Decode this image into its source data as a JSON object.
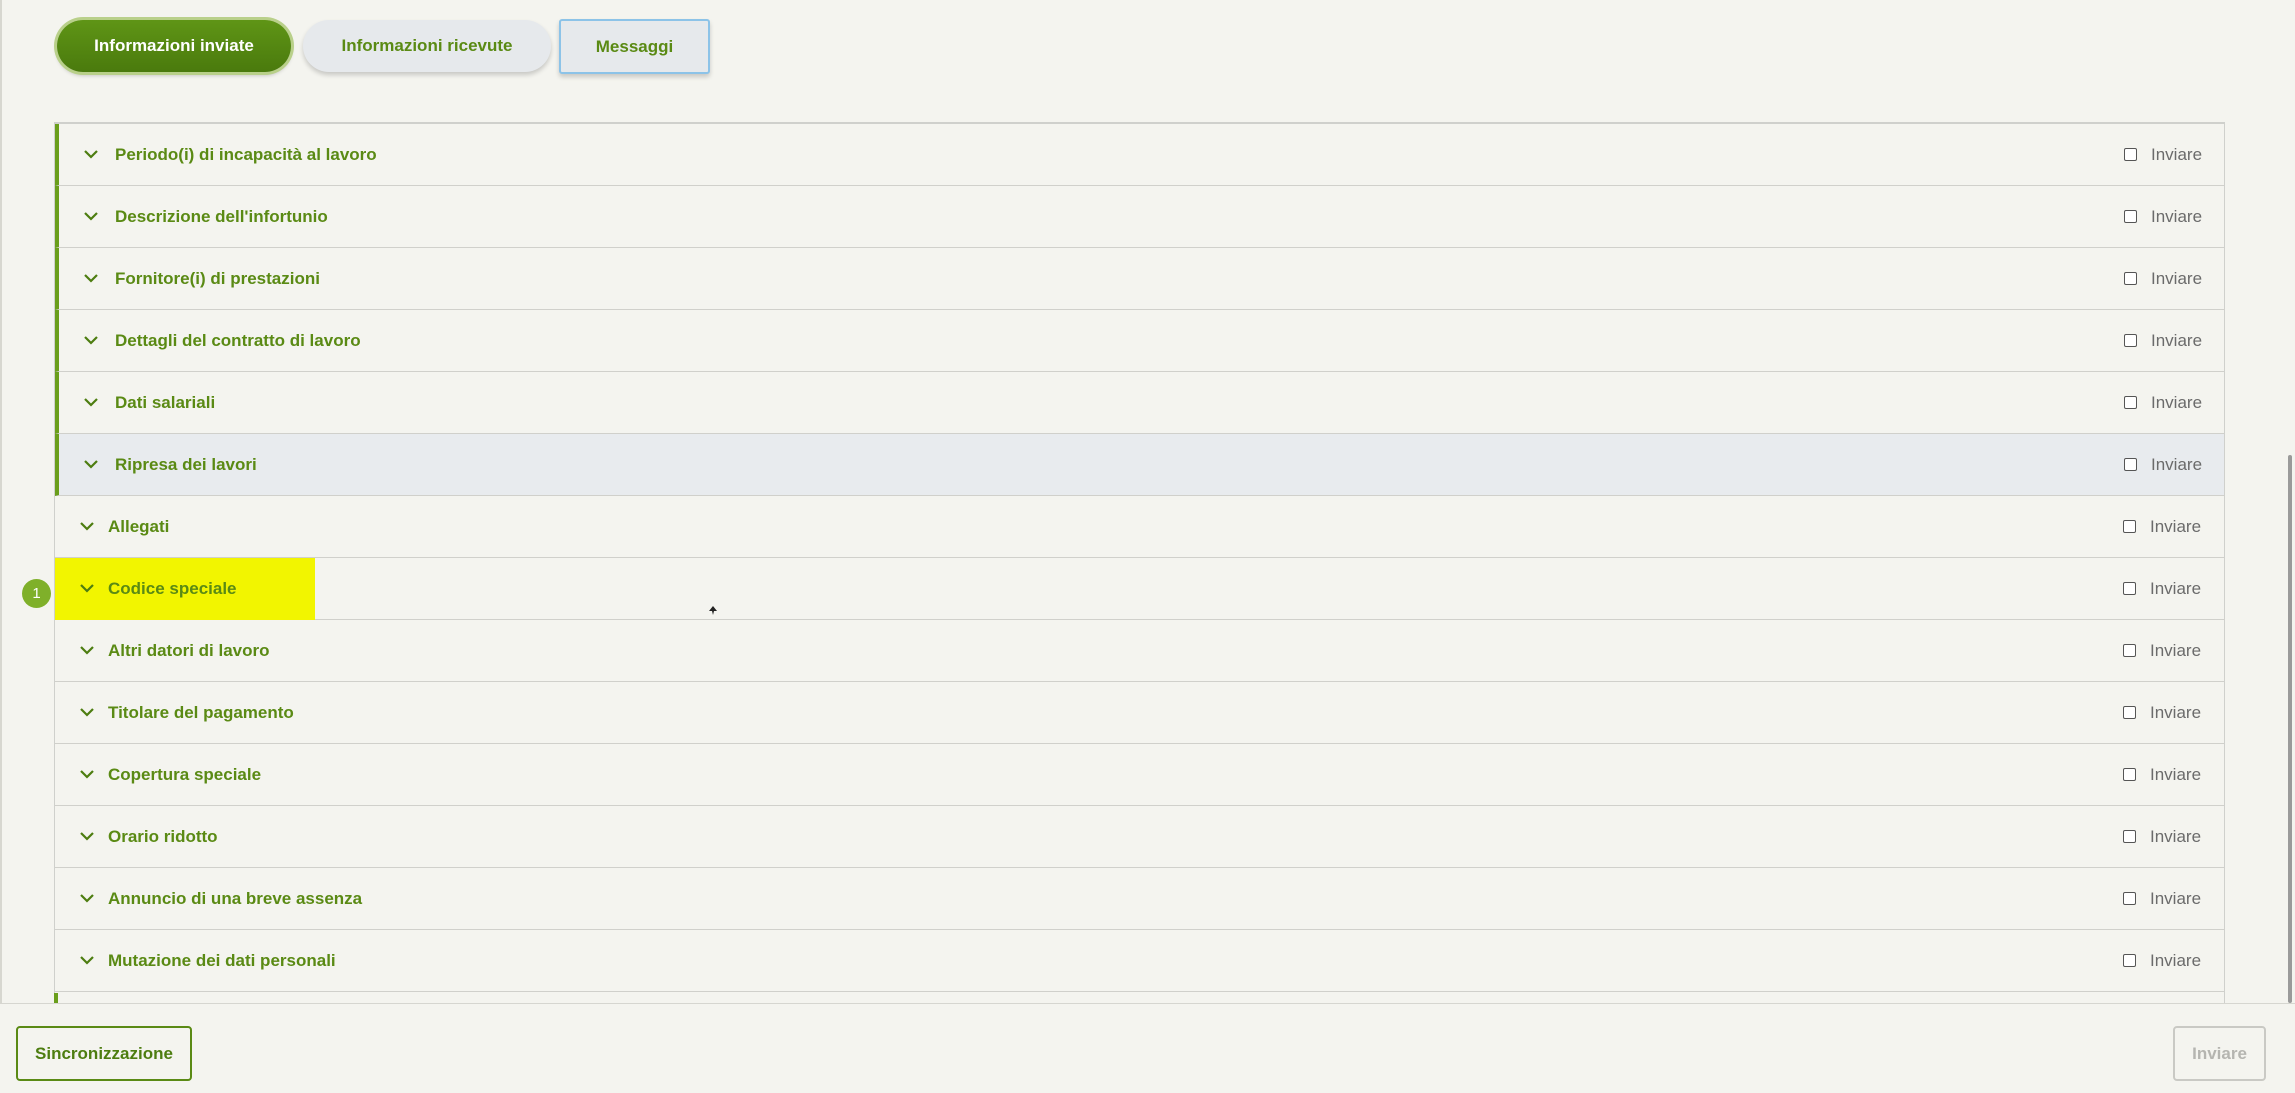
{
  "tabs": {
    "sent": "Informazioni inviate",
    "received": "Informazioni ricevute",
    "messages": "Messaggi"
  },
  "rows": [
    {
      "label": "Periodo(i) di incapacità al lavoro",
      "send": "Inviare"
    },
    {
      "label": "Descrizione dell'infortunio",
      "send": "Inviare"
    },
    {
      "label": "Fornitore(i) di prestazioni",
      "send": "Inviare"
    },
    {
      "label": "Dettagli del contratto di lavoro",
      "send": "Inviare"
    },
    {
      "label": "Dati salariali",
      "send": "Inviare"
    },
    {
      "label": "Ripresa dei lavori",
      "send": "Inviare"
    },
    {
      "label": "Allegati",
      "send": "Inviare"
    },
    {
      "label": "Codice speciale",
      "send": "Inviare"
    },
    {
      "label": "Altri datori di lavoro",
      "send": "Inviare"
    },
    {
      "label": "Titolare del pagamento",
      "send": "Inviare"
    },
    {
      "label": "Copertura speciale",
      "send": "Inviare"
    },
    {
      "label": "Orario ridotto",
      "send": "Inviare"
    },
    {
      "label": "Annuncio di una breve assenza",
      "send": "Inviare"
    },
    {
      "label": "Mutazione dei dati personali",
      "send": "Inviare"
    }
  ],
  "marker": "1",
  "footer": {
    "sync": "Sincronizzazione",
    "send": "Inviare"
  },
  "colors": {
    "accent": "#5a8a14",
    "highlight": "#f2f500",
    "background": "#f4f4ef"
  },
  "icons": {
    "chevron": "chevron-down-icon",
    "checkbox": "checkbox-icon"
  }
}
